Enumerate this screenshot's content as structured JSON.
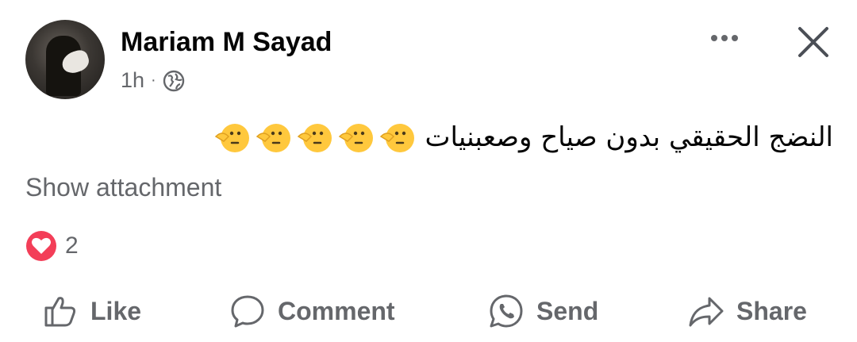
{
  "post": {
    "author": "Mariam M Sayad",
    "time": "1h",
    "separator": "·",
    "text": "النضج الحقيقي بدون صياح وصعبنيات",
    "emoji_icon": "shushing-face-icon",
    "emoji_count": 5,
    "show_attachment": "Show attachment",
    "reaction_count": "2",
    "reaction_icon": "love-reaction-icon"
  },
  "actions": {
    "like": "Like",
    "comment": "Comment",
    "send": "Send",
    "share": "Share"
  },
  "colors": {
    "secondary_text": "#65676b",
    "love_reaction": "#f33e58",
    "emoji_yellow": "#ffc83d"
  }
}
